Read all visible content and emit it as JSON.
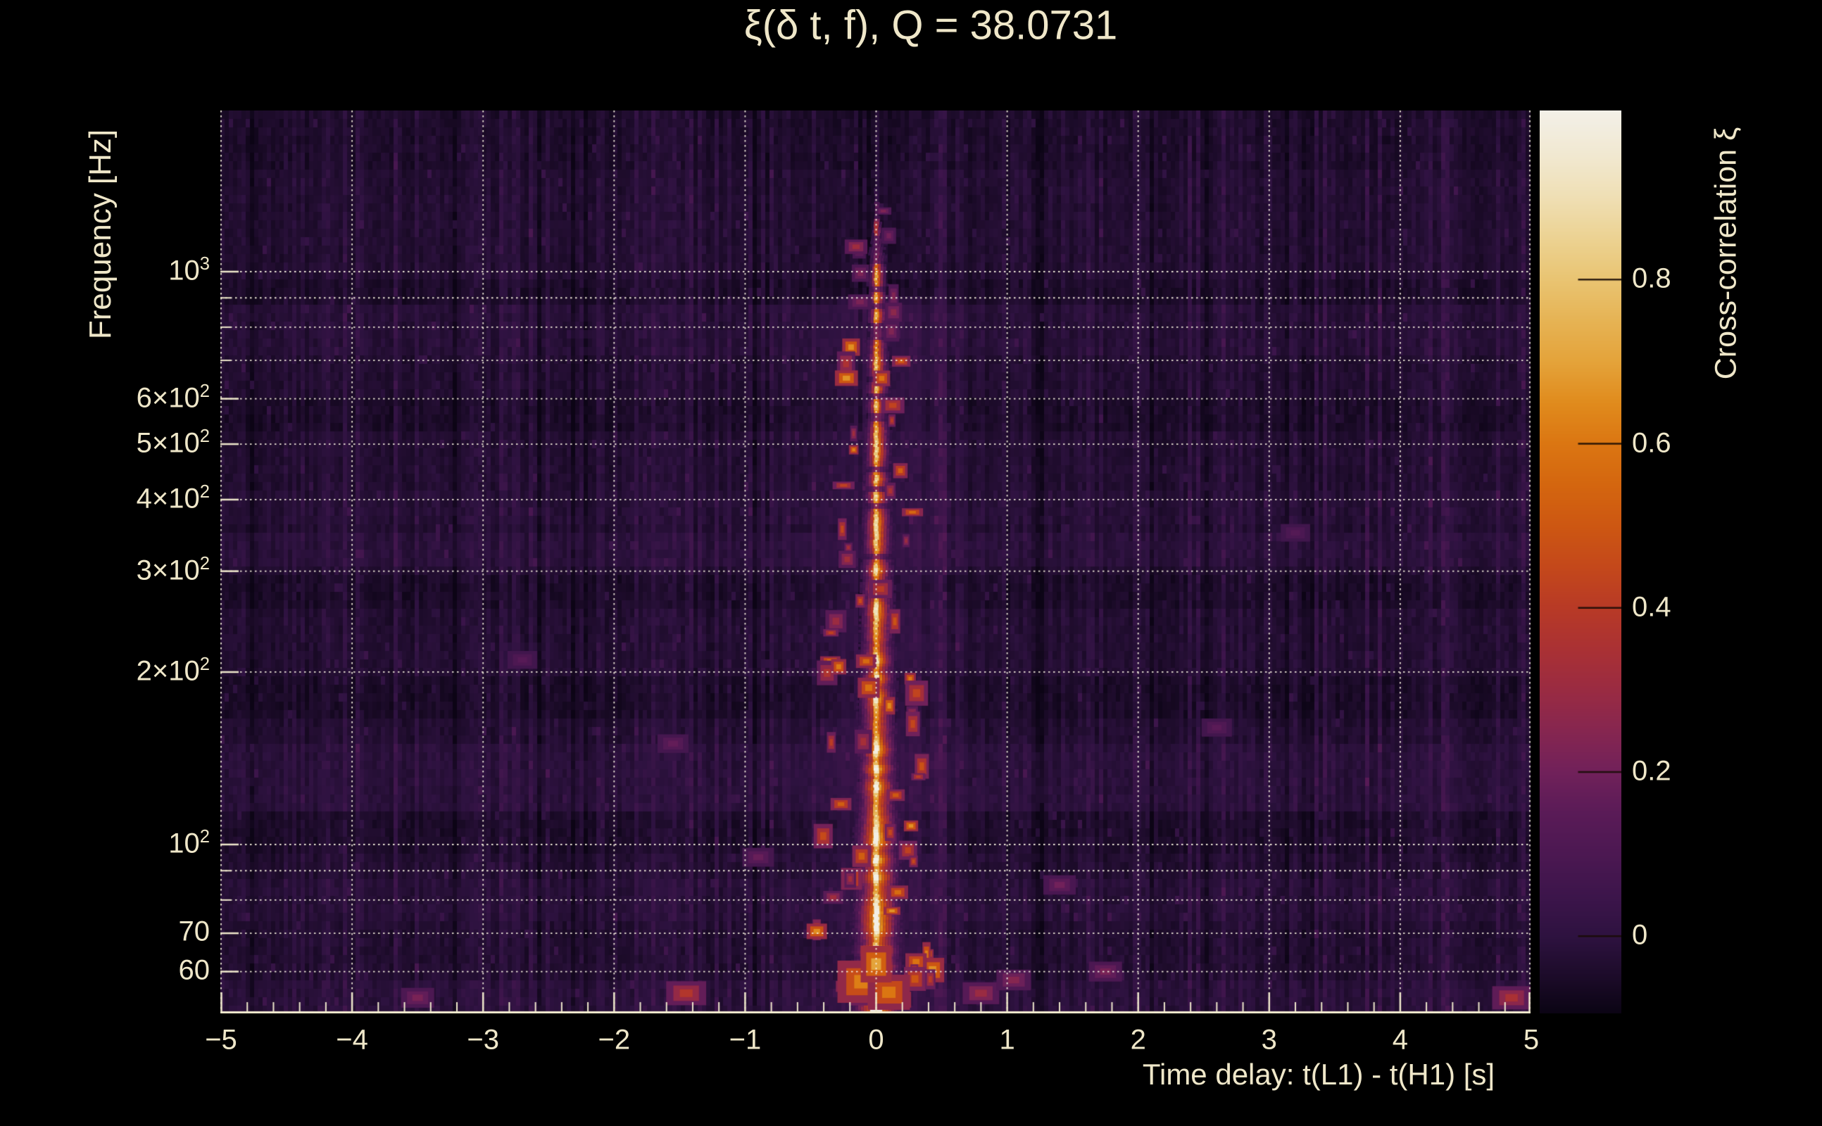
{
  "chart_data": {
    "type": "heatmap",
    "title": "ξ(δ t, f), Q = 38.0731",
    "q_value": 38.0731,
    "xlabel": "Time delay: t(L1) - t(H1) [s]",
    "ylabel": "Frequency [Hz]",
    "colorbar_label": "Cross-correlation ξ",
    "x_range_s": [
      -5,
      5
    ],
    "y_scale": "log",
    "y_range_hz": [
      50.7,
      1911
    ],
    "color_range": [
      -0.094,
      1.006
    ],
    "grid": "dotted-white",
    "x_ticks": [
      {
        "v": -5,
        "label": "−5"
      },
      {
        "v": -4,
        "label": "−4"
      },
      {
        "v": -3,
        "label": "−3"
      },
      {
        "v": -2,
        "label": "−2"
      },
      {
        "v": -1,
        "label": "−1"
      },
      {
        "v": 0,
        "label": "0"
      },
      {
        "v": 1,
        "label": "1"
      },
      {
        "v": 2,
        "label": "2"
      },
      {
        "v": 3,
        "label": "3"
      },
      {
        "v": 4,
        "label": "4"
      },
      {
        "v": 5,
        "label": "5"
      }
    ],
    "x_minor_tick_step_s": 0.2,
    "y_ticks": [
      {
        "v": 1000,
        "base": "10",
        "sup": "3"
      },
      {
        "v": 600,
        "base": "6×10",
        "sup": "2"
      },
      {
        "v": 500,
        "base": "5×10",
        "sup": "2"
      },
      {
        "v": 400,
        "base": "4×10",
        "sup": "2"
      },
      {
        "v": 300,
        "base": "3×10",
        "sup": "2"
      },
      {
        "v": 200,
        "base": "2×10",
        "sup": "2"
      },
      {
        "v": 100,
        "base": "10",
        "sup": "2"
      },
      {
        "v": 70,
        "base": "70",
        "sup": ""
      },
      {
        "v": 60,
        "base": "60",
        "sup": ""
      }
    ],
    "y_gridlines_hz": [
      60,
      70,
      80,
      90,
      100,
      200,
      300,
      400,
      500,
      600,
      700,
      800,
      900,
      1000
    ],
    "colorbar_ticks": [
      {
        "v": 0.8,
        "label": "0.8"
      },
      {
        "v": 0.6,
        "label": "0.6"
      },
      {
        "v": 0.4,
        "label": "0.4"
      },
      {
        "v": 0.2,
        "label": "0.2"
      },
      {
        "v": 0.0,
        "label": "0"
      }
    ],
    "colormap_stops": [
      [
        -0.094,
        "#0b0414"
      ],
      [
        -0.05,
        "#1c0b29"
      ],
      [
        0.0,
        "#2e1240"
      ],
      [
        0.05,
        "#3d154b"
      ],
      [
        0.1,
        "#4c1852"
      ],
      [
        0.15,
        "#5a1b57"
      ],
      [
        0.2,
        "#71215a"
      ],
      [
        0.25,
        "#862650"
      ],
      [
        0.3,
        "#9a2b42"
      ],
      [
        0.35,
        "#aa3134"
      ],
      [
        0.4,
        "#b83a26"
      ],
      [
        0.45,
        "#c4481b"
      ],
      [
        0.5,
        "#cd5712"
      ],
      [
        0.55,
        "#d4660f"
      ],
      [
        0.6,
        "#db7612"
      ],
      [
        0.65,
        "#e08b1d"
      ],
      [
        0.7,
        "#e4a33a"
      ],
      [
        0.75,
        "#e6b354"
      ],
      [
        0.8,
        "#e9c472"
      ],
      [
        0.85,
        "#ecd292"
      ],
      [
        0.9,
        "#efdfb4"
      ],
      [
        0.95,
        "#f1e8d0"
      ],
      [
        1.006,
        "#f3f0e8"
      ]
    ],
    "main_feature": {
      "description": "bright narrow cross-correlation ridge at zero time delay, spanning ~51 Hz to ~1100 Hz, widening orange glow toward low frequency",
      "time_delay_s": 0,
      "freq_span_hz": [
        51,
        1100
      ],
      "peak_xi": 1.0
    },
    "hotspots": [
      {
        "t": -3.5,
        "f": 54,
        "xi": 0.22
      },
      {
        "t": -1.45,
        "f": 55,
        "xi": 0.38
      },
      {
        "t": -0.9,
        "f": 95,
        "xi": 0.18
      },
      {
        "t": 0.8,
        "f": 55,
        "xi": 0.3
      },
      {
        "t": 1.05,
        "f": 58,
        "xi": 0.25
      },
      {
        "t": 1.4,
        "f": 85,
        "xi": 0.2
      },
      {
        "t": 1.75,
        "f": 60,
        "xi": 0.22
      },
      {
        "t": 2.6,
        "f": 160,
        "xi": 0.15
      },
      {
        "t": -1.55,
        "f": 150,
        "xi": 0.17
      },
      {
        "t": -2.7,
        "f": 210,
        "xi": 0.14
      },
      {
        "t": 3.2,
        "f": 350,
        "xi": 0.13
      },
      {
        "t": 4.85,
        "f": 54,
        "xi": 0.35
      }
    ],
    "text_color": "#EFE7C9",
    "background_color": "#000000"
  }
}
